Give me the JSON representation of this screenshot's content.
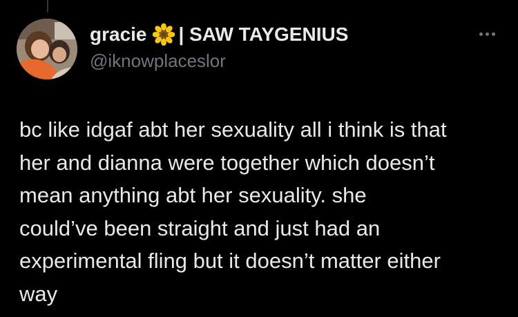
{
  "user": {
    "display_name": "gracie",
    "name_emoji_icon": "sunflower-icon",
    "name_suffix": "| SAW TAYGENIUS",
    "handle": "@iknowplaceslor",
    "avatar": "profile-photo"
  },
  "actions": {
    "more_icon": "more-horizontal-icon"
  },
  "tweet": {
    "lines": [
      "bc like idgaf abt her sexuality all i think is that",
      "her and dianna were together which doesn’t",
      "mean anything abt her sexuality. she",
      "could’ve been straight and just had an",
      "experimental fling but it doesn’t matter either",
      "way"
    ]
  },
  "colors": {
    "background": "#000000",
    "text_primary": "#e7e9ea",
    "text_secondary": "#71767b"
  }
}
